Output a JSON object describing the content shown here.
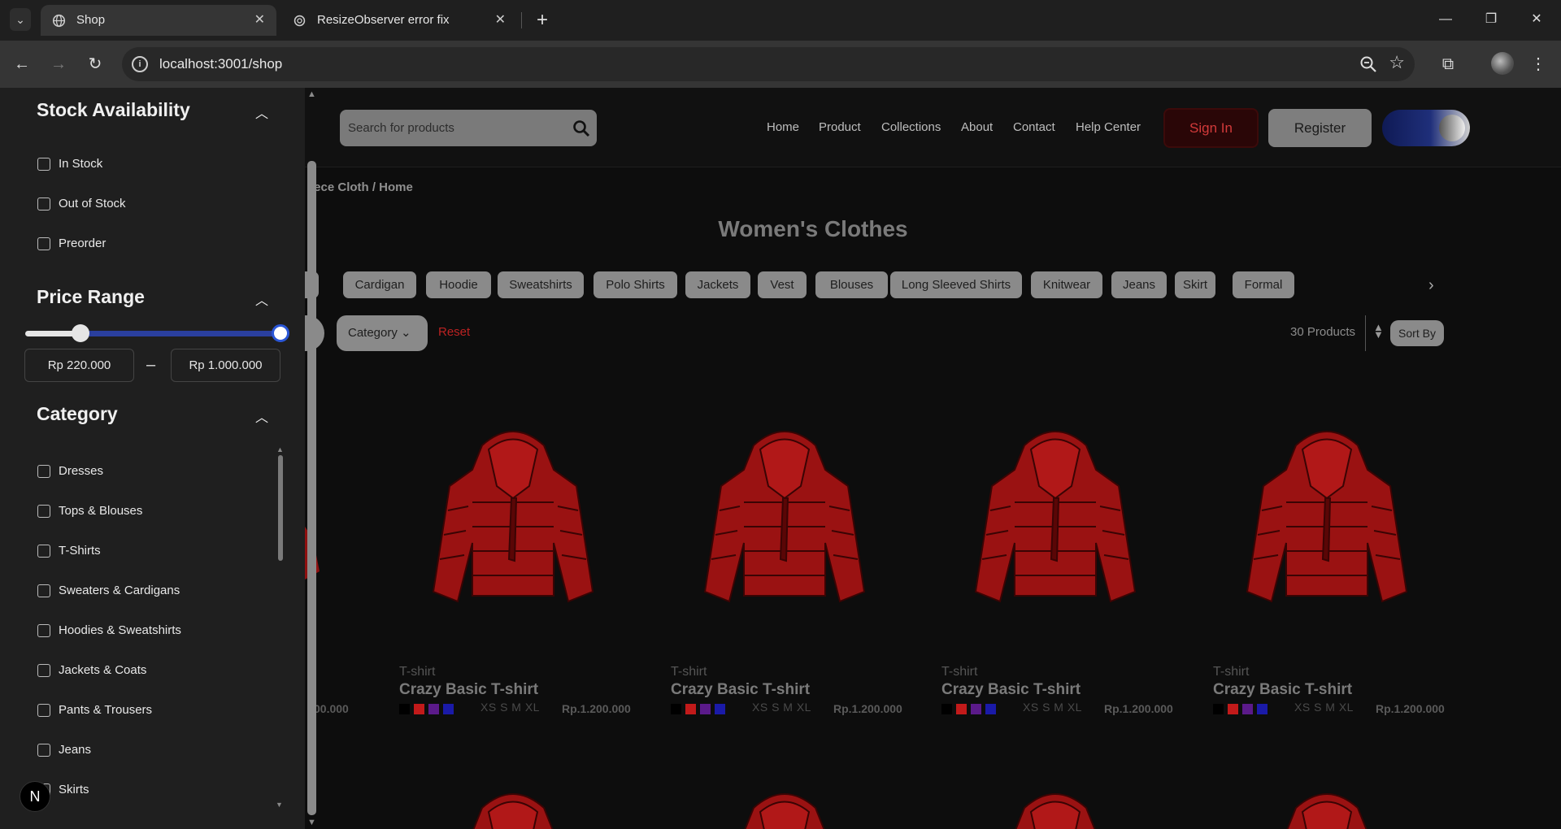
{
  "browser": {
    "tabs": [
      {
        "title": "Shop",
        "active": true
      },
      {
        "title": "ResizeObserver error fix",
        "active": false
      }
    ],
    "url": "localhost:3001/shop"
  },
  "header": {
    "search_placeholder": "Search for products",
    "nav": [
      "Home",
      "Product",
      "Collections",
      "About",
      "Contact",
      "Help Center"
    ],
    "signin_label": "Sign In",
    "register_label": "Register"
  },
  "breadcrumb": "iece Cloth / Home",
  "page_title": "Women's Clothes",
  "chips": [
    "t",
    "Cardigan",
    "Hoodie",
    "Sweatshirts",
    "Polo Shirts",
    "Jackets",
    "Vest",
    "Blouses",
    "Long Sleeved Shirts",
    "Knitwear",
    "Jeans",
    "Skirt",
    "Formal"
  ],
  "filter_bar": {
    "category_label": "Category",
    "reset_label": "Reset",
    "count_label": "30 Products",
    "sort_label": "Sort By"
  },
  "products": [
    {
      "type": "T-shirt",
      "name": "Crazy Basic T-shirt",
      "sizes": "XS S M XL",
      "price": "Rp.1.200.000"
    },
    {
      "type": "T-shirt",
      "name": "Crazy Basic T-shirt",
      "sizes": "XS S M XL",
      "price": "Rp.1.200.000"
    },
    {
      "type": "T-shirt",
      "name": "Crazy Basic T-shirt",
      "sizes": "XS S M XL",
      "price": "Rp.1.200.000"
    },
    {
      "type": "T-shirt",
      "name": "Crazy Basic T-shirt",
      "sizes": "XS S M XL",
      "price": "Rp.1.200.000"
    }
  ],
  "partial_price": "00.000",
  "swatch_colors": [
    "#000000",
    "#c21a1a",
    "#5b1a8a",
    "#1a1aa8"
  ],
  "sidebar": {
    "stock": {
      "title": "Stock Availability",
      "options": [
        "In Stock",
        "Out of Stock",
        "Preorder"
      ]
    },
    "price": {
      "title": "Price Range",
      "min_value": "Rp 220.000",
      "max_value": "Rp 1.000.000",
      "separator": "–",
      "slider_min_fraction": 0.22,
      "slider_max_fraction": 1.0
    },
    "category": {
      "title": "Category",
      "options": [
        "Dresses",
        "Tops & Blouses",
        "T-Shirts",
        "Sweaters & Cardigans",
        "Hoodies & Sweatshirts",
        "Jackets & Coats",
        "Pants & Trousers",
        "Jeans",
        "Skirts"
      ]
    }
  },
  "badge": "N",
  "colors": {
    "accent_blue": "#2a3f9e",
    "signin_red": "#d23a3a",
    "jacket_red": "#9a1212"
  }
}
